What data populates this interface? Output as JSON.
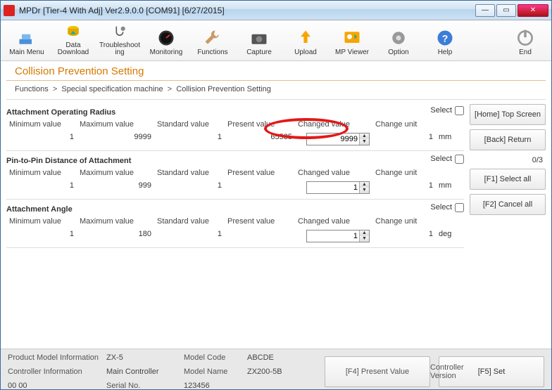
{
  "window": {
    "title": "MPDr [Tier-4 With Adj] Ver2.9.0.0 [COM91] [6/27/2015]"
  },
  "toolbar": {
    "main_menu": "Main Menu",
    "data_download": "Data\nDownload",
    "troubleshooting": "Troubleshoot\ning",
    "monitoring": "Monitoring",
    "functions": "Functions",
    "capture": "Capture",
    "upload": "Upload",
    "mp_viewer": "MP Viewer",
    "option": "Option",
    "help": "Help",
    "end": "End"
  },
  "page_title": "Collision Prevention Setting",
  "breadcrumb": {
    "a": "Functions",
    "b": "Special specification machine",
    "c": "Collision Prevention Setting"
  },
  "headers": {
    "min": "Minimum value",
    "max": "Maximum value",
    "std": "Standard value",
    "present": "Present value",
    "changed": "Changed value",
    "change_unit": "Change unit",
    "select": "Select"
  },
  "sections": [
    {
      "title": "Attachment Operating Radius",
      "min": "1",
      "max": "9999",
      "std": "1",
      "present": "65535",
      "changed": "9999",
      "change_unit": "1",
      "unit": "mm"
    },
    {
      "title": "Pin-to-Pin Distance of Attachment",
      "min": "1",
      "max": "999",
      "std": "1",
      "present": "",
      "changed": "1",
      "change_unit": "1",
      "unit": "mm"
    },
    {
      "title": "Attachment Angle",
      "min": "1",
      "max": "180",
      "std": "1",
      "present": "",
      "changed": "1",
      "change_unit": "1",
      "unit": "deg"
    }
  ],
  "side": {
    "home": "[Home] Top Screen",
    "back": "[Back] Return",
    "select_all": "[F1] Select all",
    "cancel_all": "[F2] Cancel all",
    "counter": "0/3"
  },
  "info": {
    "pmi_l": "Product Model Information",
    "pmi_v": "ZX-5",
    "ci_l": "Controller Information",
    "ci_v": "Main Controller",
    "cv_l": "Controller Version",
    "cv_v": "00 00",
    "mc_l": "Model Code",
    "mc_v": "ABCDE",
    "mn_l": "Model Name",
    "mn_v": "ZX200-5B",
    "sn_l": "Serial No.",
    "sn_v": "123456",
    "f4": "[F4] Present Value",
    "f5": "[F5] Set"
  }
}
